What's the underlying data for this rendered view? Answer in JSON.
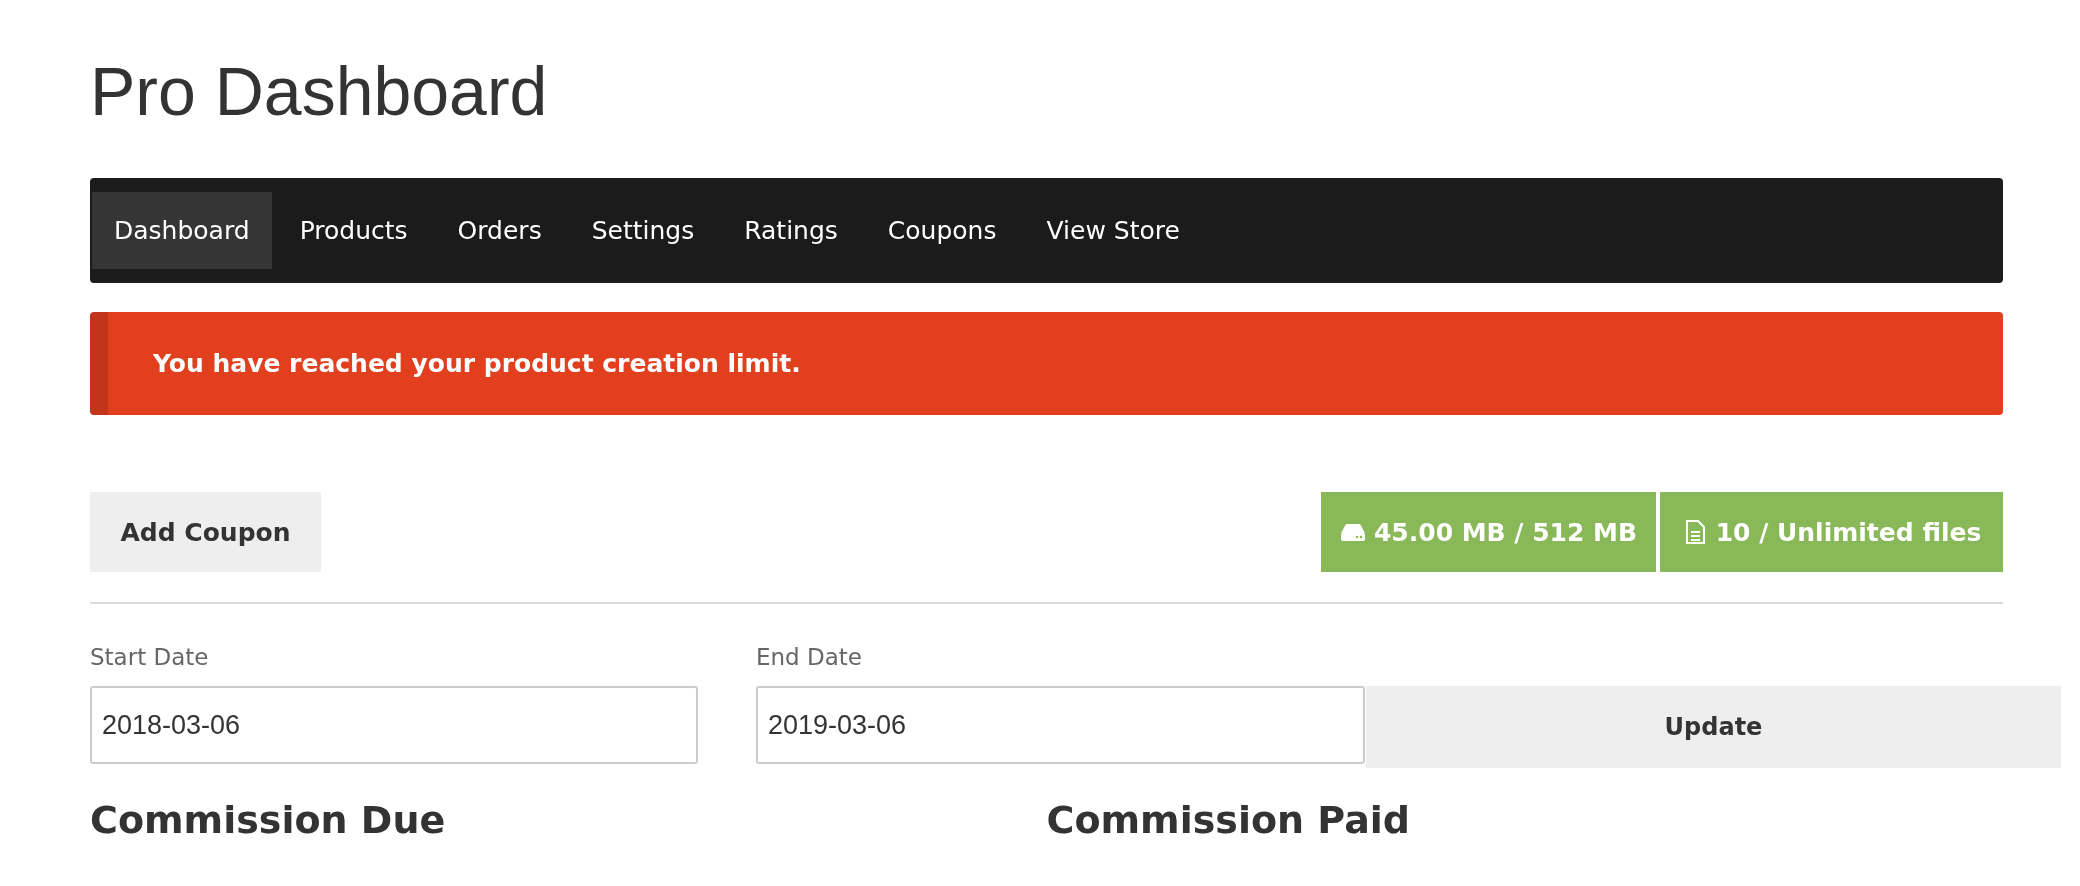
{
  "page_title": "Pro Dashboard",
  "nav": [
    {
      "label": "Dashboard",
      "selected": true
    },
    {
      "label": "Products",
      "selected": false
    },
    {
      "label": "Orders",
      "selected": false
    },
    {
      "label": "Settings",
      "selected": false
    },
    {
      "label": "Ratings",
      "selected": false
    },
    {
      "label": "Coupons",
      "selected": false
    },
    {
      "label": "View Store",
      "selected": false
    }
  ],
  "alert": {
    "text": "You have reached your product creation limit."
  },
  "add_coupon_button": "Add Coupon",
  "usage": [
    {
      "kind": "storage",
      "label": "45.00 MB / 512 MB"
    },
    {
      "kind": "files",
      "label": "10 / Unlimited files"
    }
  ],
  "date_filter": {
    "start": {
      "label": "Start Date",
      "value": "2018-03-06"
    },
    "end": {
      "label": "End Date",
      "value": "2019-03-06"
    },
    "button": "Update"
  },
  "sections": [
    "Commission Due",
    "Commission Paid"
  ]
}
